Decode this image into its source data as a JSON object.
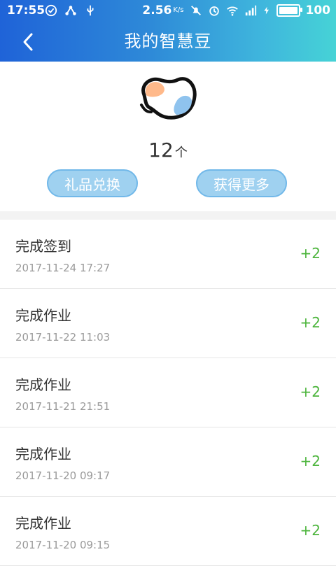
{
  "status_bar": {
    "time": "17:55",
    "net_speed": "2.56",
    "speed_unit": "K/s",
    "battery": "100"
  },
  "appbar": {
    "title": "我的智慧豆"
  },
  "balance": {
    "count": "12",
    "unit": "个"
  },
  "buttons": {
    "gift": "礼品兑换",
    "more": "获得更多"
  },
  "records": [
    {
      "name": "完成签到",
      "time": "2017-11-24 17:27",
      "points": "+2"
    },
    {
      "name": "完成作业",
      "time": "2017-11-22 11:03",
      "points": "+2"
    },
    {
      "name": "完成作业",
      "time": "2017-11-21 21:51",
      "points": "+2"
    },
    {
      "name": "完成作业",
      "time": "2017-11-20 09:17",
      "points": "+2"
    },
    {
      "name": "完成作业",
      "time": "2017-11-20 09:15",
      "points": "+2"
    }
  ],
  "colors": {
    "header_start": "#1f63d8",
    "header_end": "#46d3d6",
    "points_green": "#4db53d",
    "button_fill": "#9fd1f0"
  }
}
